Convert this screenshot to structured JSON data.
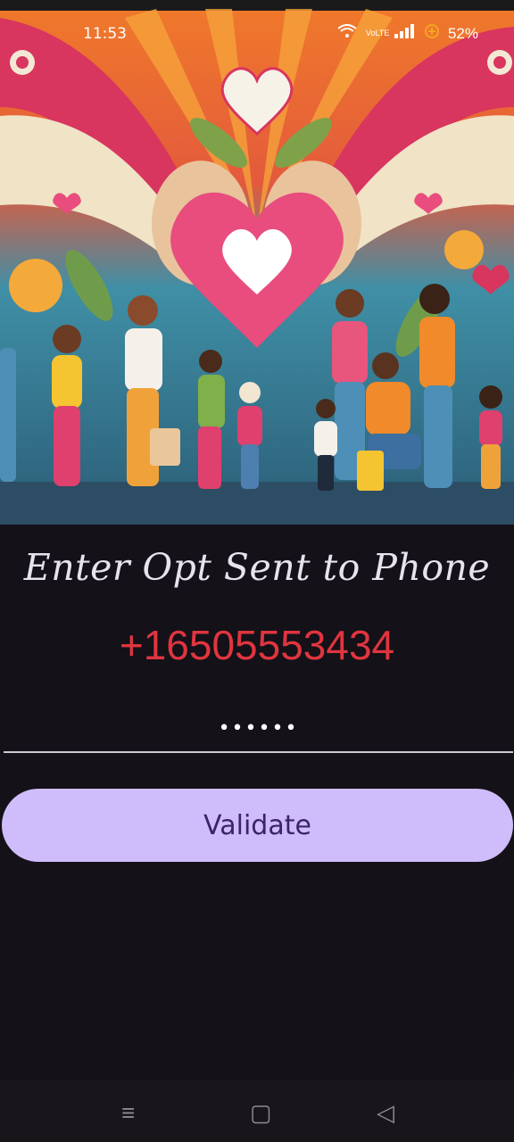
{
  "status_bar": {
    "time": "11:53",
    "network_label": "VoLTE",
    "battery": "52%"
  },
  "otp_screen": {
    "title": "Enter Opt Sent to Phone",
    "phone_number": "+16505553434",
    "otp_value": "••••••",
    "validate_label": "Validate"
  },
  "nav_bar": {
    "recent_icon": "≡",
    "home_icon": "▢",
    "back_icon": "◁"
  },
  "colors": {
    "background": "#141118",
    "phone_text": "#e0353f",
    "button_bg": "#cfbdfb",
    "button_text": "#3b2468"
  }
}
